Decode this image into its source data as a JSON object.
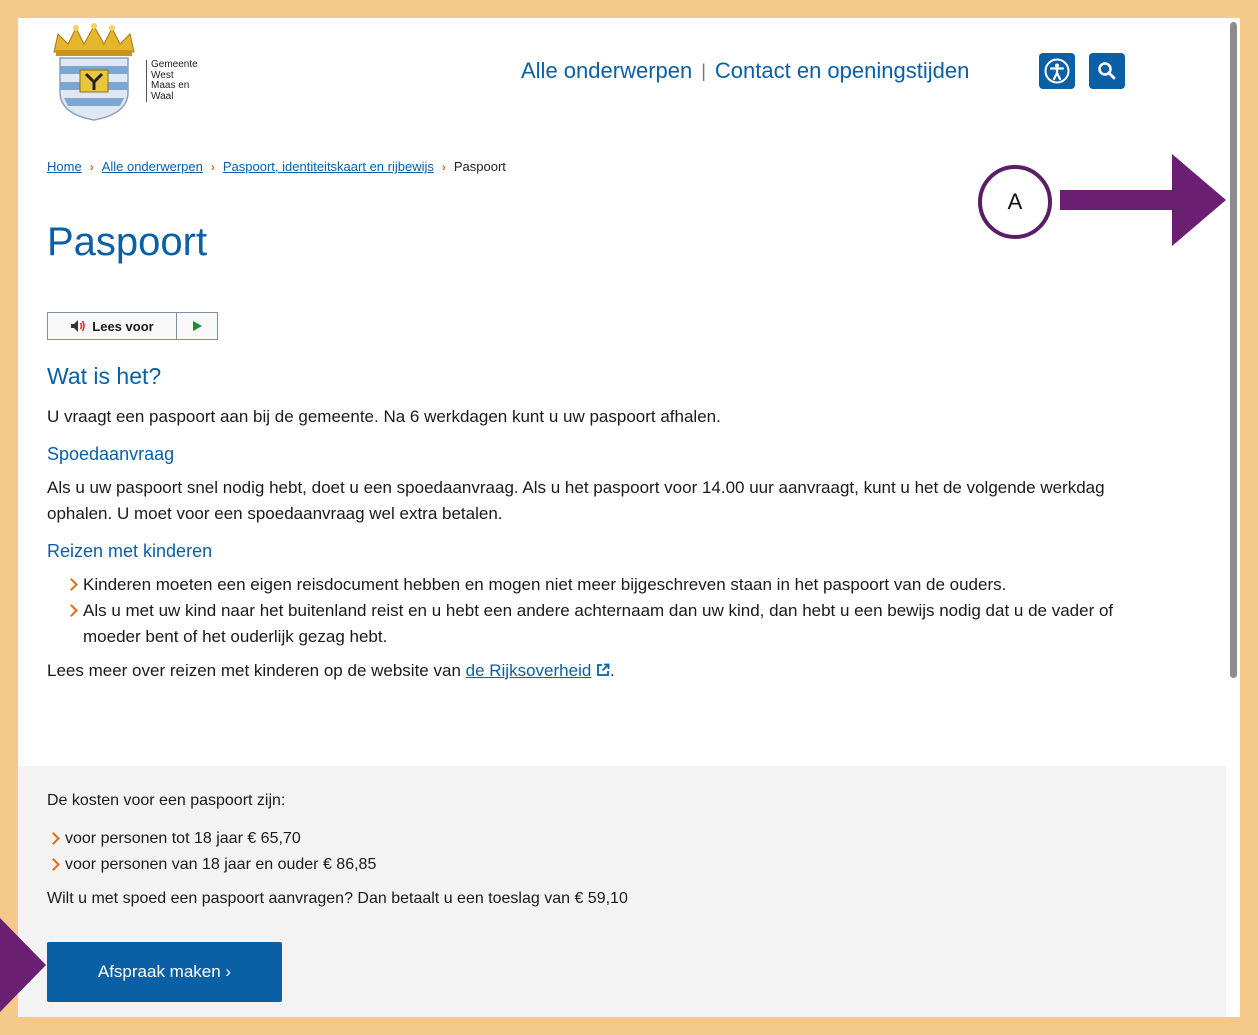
{
  "header": {
    "municipality_lines": [
      "Gemeente",
      "West",
      "Maas en",
      "Waal"
    ],
    "nav": [
      "Alle onderwerpen",
      "Contact en openingstijden"
    ]
  },
  "breadcrumb": {
    "items": [
      "Home",
      "Alle onderwerpen",
      "Paspoort, identiteitskaart en rijbewijs"
    ],
    "current": "Paspoort"
  },
  "page": {
    "title": "Paspoort",
    "readspeaker_label": "Lees voor"
  },
  "sections": {
    "wat_heading": "Wat is het?",
    "wat_text": "U vraagt een paspoort aan bij de gemeente. Na 6 werkdagen kunt u uw paspoort afhalen.",
    "spoed_heading": "Spoedaanvraag",
    "spoed_text": "Als u uw paspoort snel nodig hebt, doet u een spoedaanvraag. Als u het paspoort voor 14.00 uur aanvraagt, kunt u het de volgende werkdag ophalen. U moet voor een spoedaanvraag wel extra betalen.",
    "kinderen_heading": "Reizen met kinderen",
    "kinderen_items": [
      "Kinderen moeten een eigen reisdocument hebben en mogen niet meer bijgeschreven staan in het paspoort van de ouders.",
      "Als u met uw kind naar het buitenland reist en u hebt een andere achternaam dan uw kind, dan hebt u een bewijs nodig dat u de vader of moeder bent of het ouderlijk gezag hebt."
    ],
    "lees_meer_prefix": "Lees meer over reizen met kinderen op de website van ",
    "lees_meer_link": "de Rijksoverheid",
    "lees_meer_suffix": "."
  },
  "costs": {
    "intro": "De kosten voor een paspoort zijn:",
    "items": [
      "voor personen tot 18 jaar € 65,70",
      "voor personen van 18 jaar en ouder € 86,85"
    ],
    "spoed_note": "Wilt u met spoed een paspoort aanvragen? Dan betaalt u een toeslag van € 59,10",
    "cta_label": "Afspraak maken ›"
  },
  "annotation": {
    "label": "A",
    "color": "#6a1f73"
  },
  "colors": {
    "brand_blue": "#0b5fa5",
    "accent_orange": "#e36b12",
    "frame": "#f5c98a"
  },
  "icons": [
    "coat-of-arms-logo",
    "accessibility-icon",
    "search-icon",
    "speaker-icon",
    "play-icon",
    "external-link-icon",
    "chevron-right-icon"
  ]
}
